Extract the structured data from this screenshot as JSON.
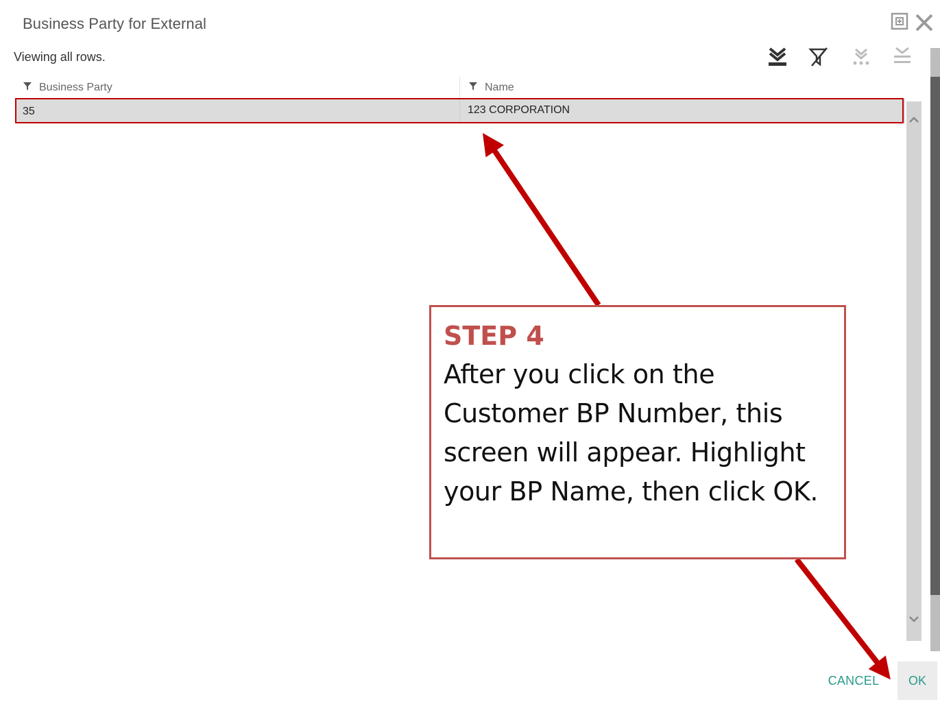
{
  "dialog": {
    "title": "Business Party for External",
    "status_text": "Viewing all rows."
  },
  "toolbar": {
    "icons": [
      "export-icon",
      "clear-filter-icon",
      "more-export-icon",
      "collapse-icon"
    ]
  },
  "grid": {
    "columns": [
      {
        "label": "Business Party",
        "icon": "filter-icon"
      },
      {
        "label": "Name",
        "icon": "filter-icon"
      }
    ],
    "rows": [
      {
        "business_party": "35",
        "name": "123 CORPORATION"
      }
    ]
  },
  "buttons": {
    "cancel_label": "CANCEL",
    "ok_label": "OK"
  },
  "callout": {
    "title": "STEP 4",
    "body": "After you click on the Customer BP Number, this screen will appear. Highlight your BP Name, then click OK."
  },
  "colors": {
    "accent_teal": "#2a9a8c",
    "annotation_red": "#c00000",
    "callout_border": "#c0504d",
    "row_selected": "#dcdcdc"
  }
}
